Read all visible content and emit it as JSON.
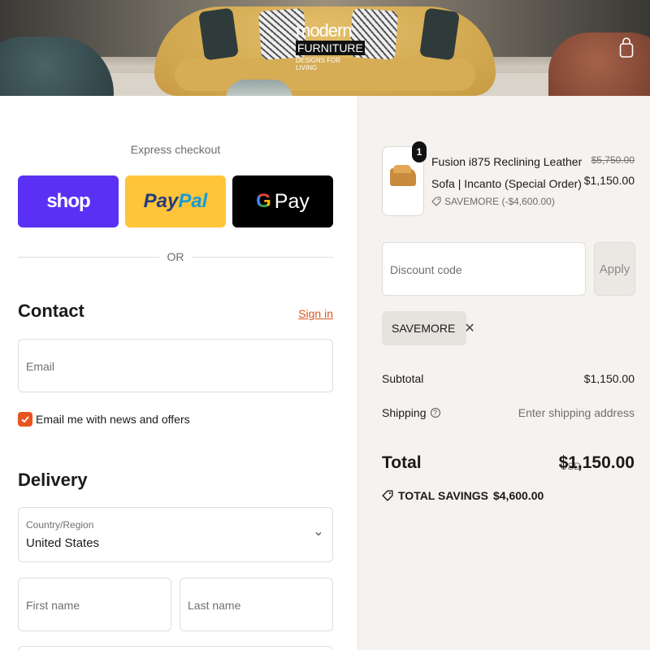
{
  "header": {
    "logo_line1": "modern",
    "logo_line2": "FURNITURE",
    "logo_tagline": "DESIGNS FOR LIVING"
  },
  "express": {
    "label": "Express checkout",
    "shop_label": "shop",
    "paypal_part1": "Pay",
    "paypal_part2": "Pal",
    "gpay_g": "G",
    "gpay_label": "Pay",
    "or_label": "OR"
  },
  "contact": {
    "title": "Contact",
    "signin_label": "Sign in",
    "email_placeholder": "Email",
    "newsletter_label": "Email me with news and offers",
    "newsletter_checked": true
  },
  "delivery": {
    "title": "Delivery",
    "country_label": "Country/Region",
    "country_value": "United States",
    "first_name_placeholder": "First name",
    "last_name_placeholder": "Last name"
  },
  "order": {
    "quantity": "1",
    "product_name": "Fusion i875 Reclining Leather Sofa | Incanto (Special Order)",
    "discount_tag": "SAVEMORE (-$4,600.00)",
    "original_price": "$5,750.00",
    "price": "$1,150.00",
    "discount_placeholder": "Discount code",
    "apply_label": "Apply",
    "applied_code": "SAVEMORE",
    "subtotal_label": "Subtotal",
    "subtotal_value": "$1,150.00",
    "shipping_label": "Shipping",
    "shipping_value": "Enter shipping address",
    "total_label": "Total",
    "currency": "USD",
    "total_value": "$1,150.00",
    "savings_label": "TOTAL SAVINGS",
    "savings_value": "$4,600.00"
  },
  "colors": {
    "accent": "#e8531f",
    "shop": "#5a31f4",
    "paypal": "#ffc439",
    "gpay": "#000000"
  }
}
